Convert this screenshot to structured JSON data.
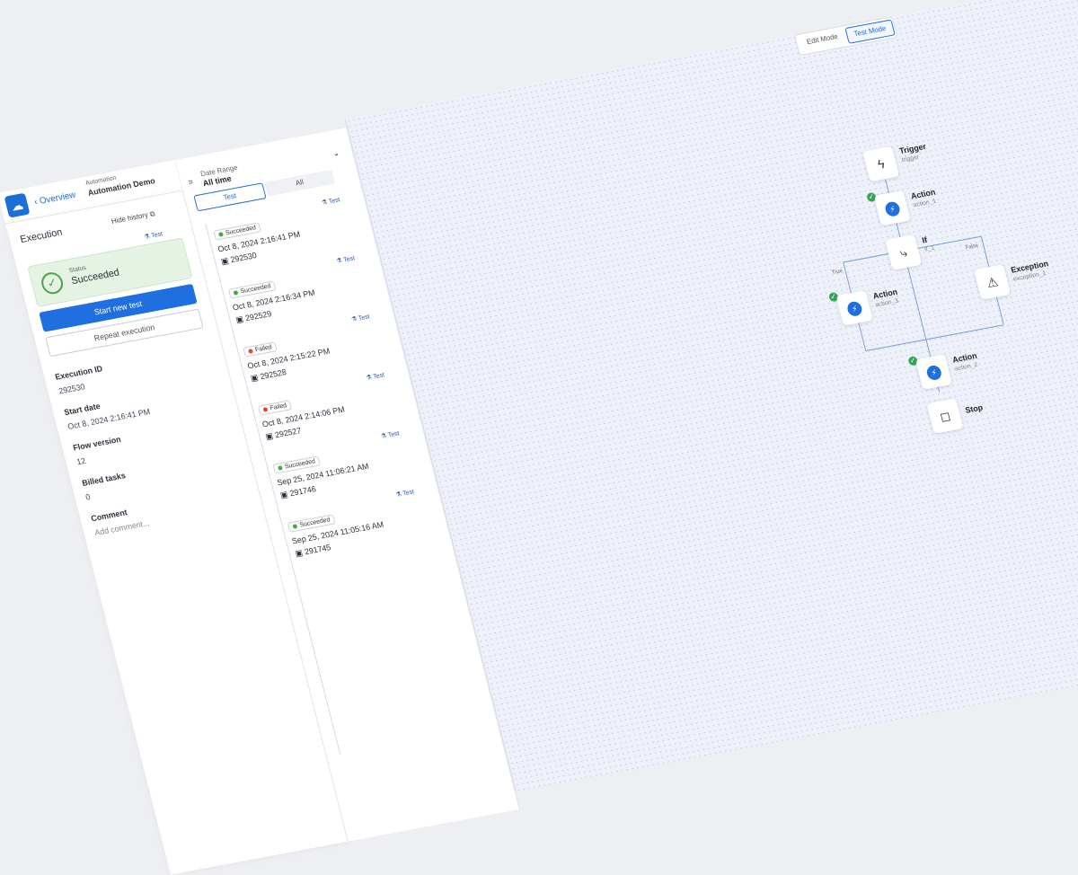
{
  "header": {
    "overview_label": "Overview",
    "crumb_small": "Automation",
    "crumb_title": "Automation Demo"
  },
  "execution": {
    "title": "Execution",
    "hide_history": "Hide history",
    "tag": "Test",
    "status_label": "Status",
    "status_value": "Succeeded",
    "start_new_test": "Start new test",
    "repeat_execution": "Repeat execution",
    "fields": [
      {
        "label": "Execution ID",
        "value": "292530"
      },
      {
        "label": "Start date",
        "value": "Oct 8, 2024 2:16:41 PM"
      },
      {
        "label": "Flow version",
        "value": "12"
      },
      {
        "label": "Billed tasks",
        "value": "0"
      },
      {
        "label": "Comment",
        "value": "Add comment..."
      }
    ]
  },
  "history": {
    "date_range_label": "Date Range",
    "date_range_value": "All time",
    "tabs": [
      "Test",
      "All"
    ],
    "items": [
      {
        "status": "Succeeded",
        "date": "Oct 8, 2024 2:16:41 PM",
        "id": "292530",
        "tag": "Test"
      },
      {
        "status": "Succeeded",
        "date": "Oct 8, 2024 2:16:34 PM",
        "id": "292529",
        "tag": "Test"
      },
      {
        "status": "Failed",
        "date": "Oct 8, 2024 2:15:22 PM",
        "id": "292528",
        "tag": "Test"
      },
      {
        "status": "Failed",
        "date": "Oct 8, 2024 2:14:06 PM",
        "id": "292527",
        "tag": "Test"
      },
      {
        "status": "Succeeded",
        "date": "Sep 25, 2024 11:06:21 AM",
        "id": "291746",
        "tag": "Test"
      },
      {
        "status": "Succeeded",
        "date": "Sep 25, 2024 11:05:16 AM",
        "id": "291745",
        "tag": "Test"
      }
    ]
  },
  "modes": {
    "edit": "Edit Mode",
    "test": "Test Mode"
  },
  "flow": {
    "trigger": {
      "title": "Trigger",
      "sub": "trigger"
    },
    "action1": {
      "title": "Action",
      "sub": "action_1"
    },
    "if": {
      "title": "If",
      "sub": "if_1"
    },
    "exception": {
      "title": "Exception",
      "sub": "exception_1"
    },
    "action3": {
      "title": "Action",
      "sub": "action_3"
    },
    "action2": {
      "title": "Action",
      "sub": "action_2"
    },
    "stop": {
      "title": "Stop"
    },
    "true_label": "True",
    "false_label": "False"
  },
  "colors": {
    "accent": "#1f6fe0",
    "success": "#49a545",
    "failed": "#e0453a"
  }
}
